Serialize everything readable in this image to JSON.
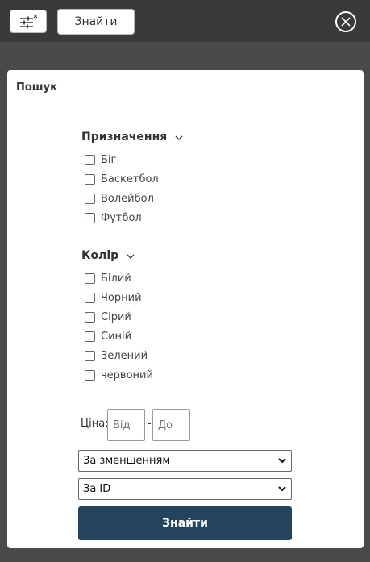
{
  "toolbar": {
    "filter_icon": "sliders-icon",
    "search_label": "Знайти",
    "close_icon": "close-circle-icon"
  },
  "panel": {
    "title": "Пошук",
    "purpose": {
      "label": "Призначення",
      "options": [
        "Біг",
        "Баскетбол",
        "Волейбол",
        "Футбол"
      ]
    },
    "color": {
      "label": "Колір",
      "options": [
        "Білий",
        "Чорний",
        "Сірий",
        "Синій",
        "Зелений",
        "червоний"
      ]
    },
    "price": {
      "label": "Ціна:",
      "from_placeholder": "Від",
      "dash": "-",
      "to_placeholder": "До"
    },
    "sort_select": {
      "value": "За зменшенням"
    },
    "order_select": {
      "value": "За ID"
    },
    "submit_label": "Знайти"
  },
  "colors": {
    "backdrop": "#4a4a4a",
    "topbar": "#3a3a3a",
    "submit_bg": "#23445c"
  }
}
